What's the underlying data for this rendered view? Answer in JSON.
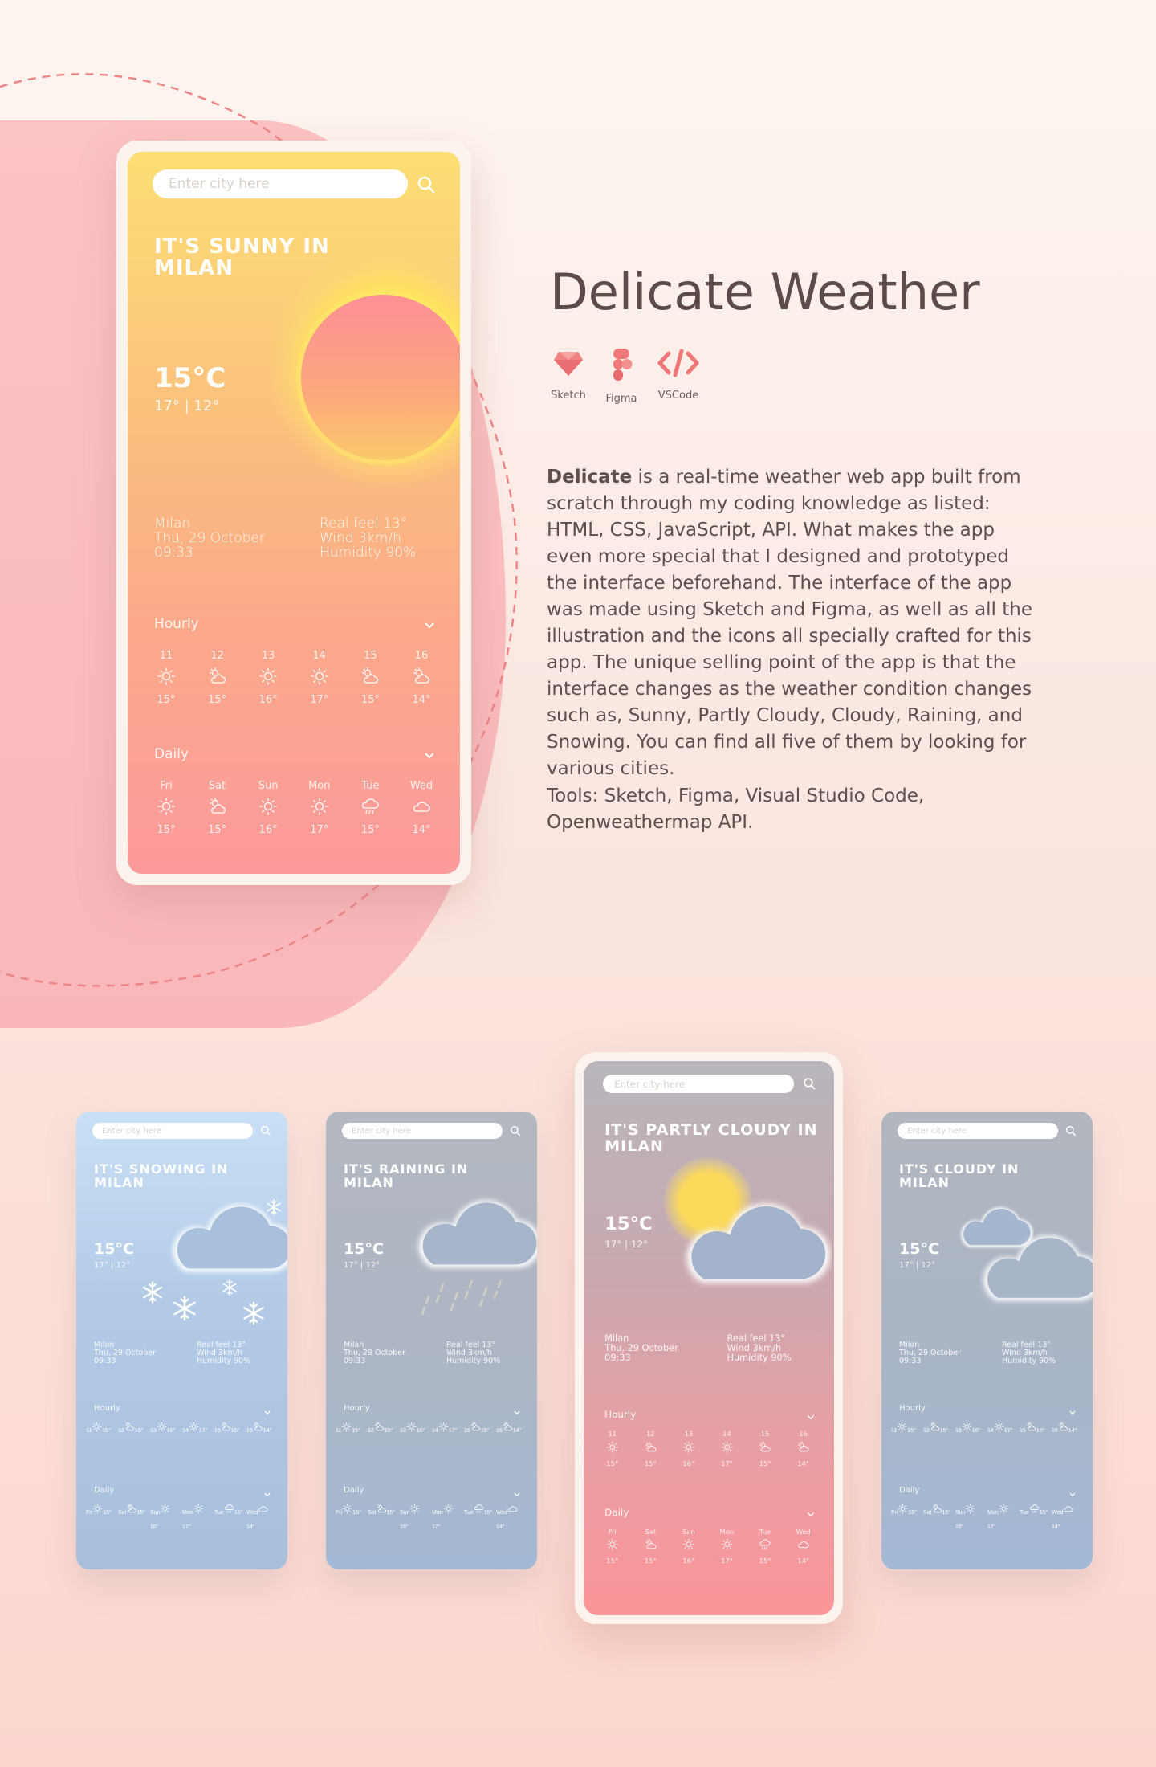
{
  "project": {
    "title": "Delicate Weather",
    "tools": [
      {
        "name": "Sketch",
        "icon": "sketch-diamond-icon",
        "color": "#f07878"
      },
      {
        "name": "Figma",
        "icon": "figma-logo-icon",
        "color": "#f07878"
      },
      {
        "name": "VSCode",
        "icon": "code-brackets-icon",
        "color": "#f07878"
      }
    ],
    "description_bold": "Delicate",
    "description_rest": " is a real-time weather web app built from scratch through my coding knowledge as listed: HTML, CSS, JavaScript, API. What makes the app even more special that I designed and prototyped the interface beforehand. The interface of the app was made using Sketch and Figma, as well as all the illustration and the icons all specially crafted for this app. The unique selling point of the app is that the interface changes as the weather condition changes such as, Sunny, Partly Cloudy, Cloudy, Raining, and Snowing. You can find all five of them by looking for various cities.",
    "tools_line": "Tools: Sketch, Figma, Visual Studio Code, Openweathermap API."
  },
  "app": {
    "search_placeholder": "Enter city here",
    "temp": "15°C",
    "range": "17° | 12°",
    "location_info": "Milan\nThu, 29 October\n09:33",
    "details_info": "Real feel 13°\nWind 3km/h\nHumidity 90%",
    "hourly_label": "Hourly",
    "daily_label": "Daily",
    "hourly": [
      {
        "label": "11",
        "icon": "sun-icon",
        "temp": "15°"
      },
      {
        "label": "12",
        "icon": "partly-cloudy-icon",
        "temp": "15°"
      },
      {
        "label": "13",
        "icon": "sun-icon",
        "temp": "16°"
      },
      {
        "label": "14",
        "icon": "sun-icon",
        "temp": "17°"
      },
      {
        "label": "15",
        "icon": "partly-cloudy-icon",
        "temp": "15°"
      },
      {
        "label": "16",
        "icon": "partly-cloudy-icon",
        "temp": "14°"
      }
    ],
    "daily": [
      {
        "label": "Fri",
        "icon": "sun-icon",
        "temp": "15°"
      },
      {
        "label": "Sat",
        "icon": "partly-cloudy-icon",
        "temp": "15°"
      },
      {
        "label": "Sun",
        "icon": "sun-icon",
        "temp": "16°"
      },
      {
        "label": "Mon",
        "icon": "sun-icon",
        "temp": "17°"
      },
      {
        "label": "Tue",
        "icon": "rain-cloud-icon",
        "temp": "15°"
      },
      {
        "label": "Wed",
        "icon": "cloud-icon",
        "temp": "14°"
      }
    ]
  },
  "screens": {
    "sunny": {
      "title": "IT'S SUNNY IN\nMILAN"
    },
    "snowing": {
      "title": "IT'S SNOWING IN\nMILAN"
    },
    "raining": {
      "title": "IT'S RAINING IN\nMILAN"
    },
    "partly": {
      "title": "IT'S PARTLY CLOUDY IN\nMILAN"
    },
    "cloudy": {
      "title": "IT'S CLOUDY IN\nMILAN"
    }
  }
}
